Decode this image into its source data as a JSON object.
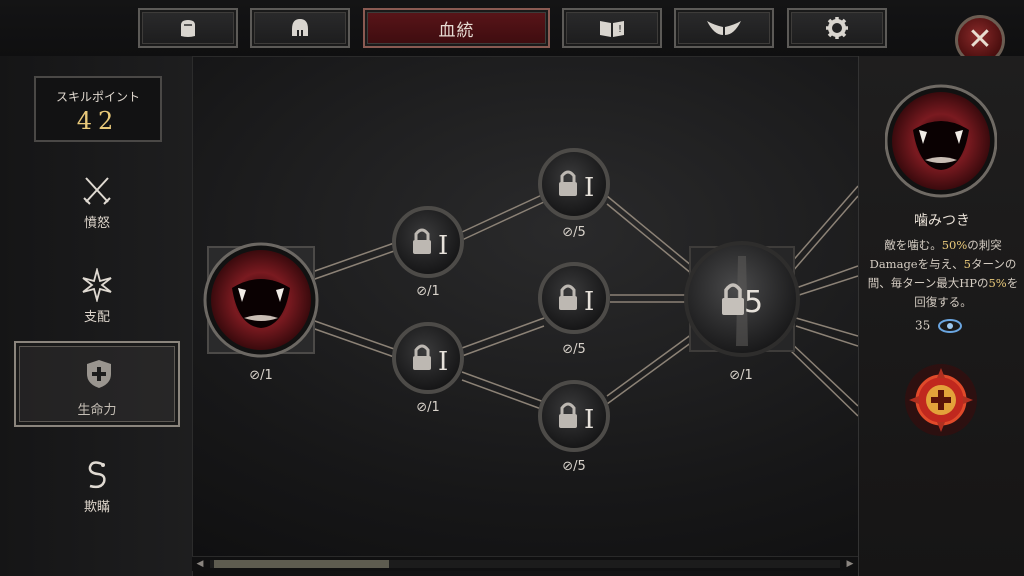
{
  "tabs": [
    {
      "id": "gear",
      "label": "",
      "icon": "bag-icon"
    },
    {
      "id": "helmet",
      "label": "",
      "icon": "helmet-icon"
    },
    {
      "id": "bloodline",
      "label": "血統",
      "icon": ""
    },
    {
      "id": "codex",
      "label": "",
      "icon": "book-icon"
    },
    {
      "id": "wings",
      "label": "",
      "icon": "wings-icon"
    },
    {
      "id": "settings",
      "label": "",
      "icon": "gear-icon"
    }
  ],
  "active_tab": "血統",
  "close_icon": "close-icon",
  "skill_points": {
    "label": "スキルポイント",
    "value": "42"
  },
  "categories": [
    {
      "label": "憤怒",
      "icon": "crossed-swords-icon"
    },
    {
      "label": "支配",
      "icon": "star-burst-icon"
    },
    {
      "label": "生命力",
      "icon": "shield-cross-icon"
    },
    {
      "label": "欺瞞",
      "icon": "serpent-icon"
    }
  ],
  "active_category": "生命力",
  "nodes": [
    {
      "id": "bite",
      "count": "⊘/1",
      "badge": "",
      "locked": false
    },
    {
      "id": "t1a",
      "count": "⊘/1",
      "badge": "I",
      "locked": true
    },
    {
      "id": "t1b",
      "count": "⊘/1",
      "badge": "I",
      "locked": false
    },
    {
      "id": "t2a",
      "count": "⊘/5",
      "badge": "I",
      "locked": true
    },
    {
      "id": "t2b",
      "count": "⊘/5",
      "badge": "I",
      "locked": true
    },
    {
      "id": "t2c",
      "count": "⊘/5",
      "badge": "I",
      "locked": true
    },
    {
      "id": "t3",
      "count": "⊘/1",
      "badge": "5",
      "locked": true
    }
  ],
  "detail": {
    "name": "噛みつき",
    "desc_parts": [
      "敵を噛む。",
      "50%",
      "の刺突Damageを与え、",
      "5",
      "ターンの間、毎ターン最大HPの",
      "5%",
      "を回復する。"
    ],
    "cost": "35"
  },
  "colors": {
    "accent": "#e9c97a",
    "active_tab": "#5a1519",
    "close": "#8a2a2a"
  }
}
